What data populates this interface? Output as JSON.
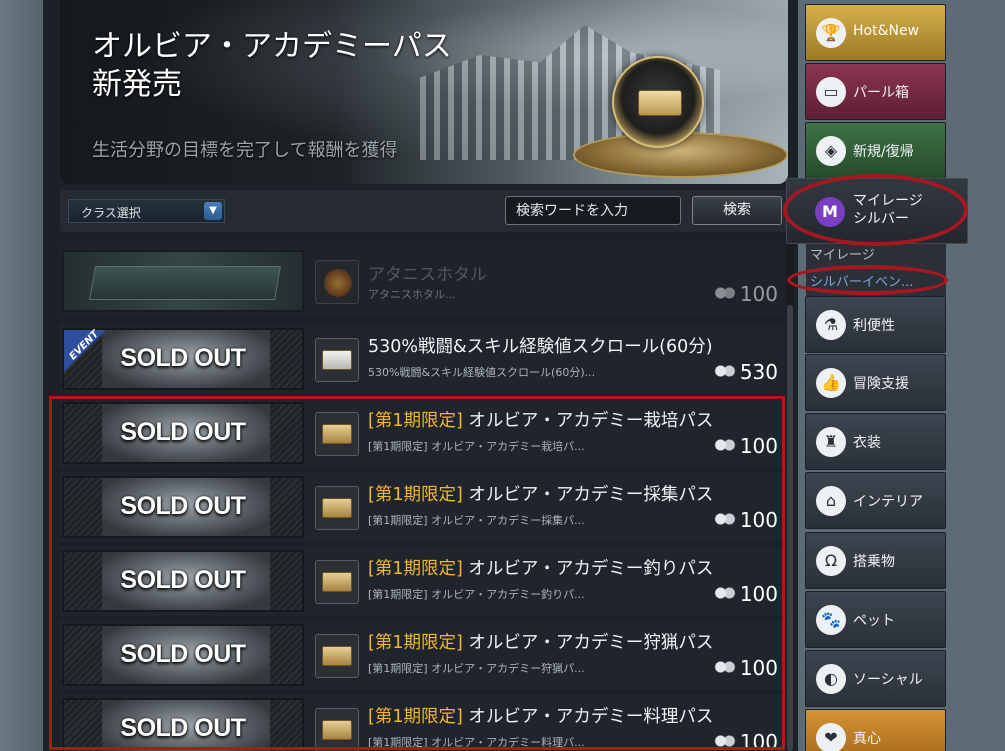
{
  "banner": {
    "title": "オルビア・アカデミーパス\n新発売",
    "subtitle": "生活分野の目標を完了して報酬を獲得"
  },
  "filter": {
    "class_select": "クラス選択",
    "search_placeholder": "検索ワードを入力",
    "search_button": "検索"
  },
  "items": [
    {
      "title": "アタニスホタル",
      "tag": "",
      "desc": "アタニスホタル...",
      "price": "100",
      "thumb": ""
    },
    {
      "title": "530%戦闘&スキル経験値スクロール(60分)",
      "tag": "",
      "desc": "530%戦闘&スキル経験値スクロール(60分)...",
      "price": "530",
      "thumb": "SOLD OUT",
      "ribbon": "EVENT"
    },
    {
      "title": "オルビア・アカデミー栽培パス",
      "tag": "[第1期限定]",
      "desc": "[第1期限定] オルビア・アカデミー栽培パ...",
      "price": "100",
      "thumb": "SOLD OUT"
    },
    {
      "title": "オルビア・アカデミー採集パス",
      "tag": "[第1期限定]",
      "desc": "[第1期限定] オルビア・アカデミー採集パ...",
      "price": "100",
      "thumb": "SOLD OUT"
    },
    {
      "title": "オルビア・アカデミー釣りパス",
      "tag": "[第1期限定]",
      "desc": "[第1期限定] オルビア・アカデミー釣りパ...",
      "price": "100",
      "thumb": "SOLD OUT"
    },
    {
      "title": "オルビア・アカデミー狩猟パス",
      "tag": "[第1期限定]",
      "desc": "[第1期限定] オルビア・アカデミー狩猟パ...",
      "price": "100",
      "thumb": "SOLD OUT"
    },
    {
      "title": "オルビア・アカデミー料理パス",
      "tag": "[第1期限定]",
      "desc": "[第1期限定] オルビア・アカデミー料理パ...",
      "price": "100",
      "thumb": "SOLD OUT"
    }
  ],
  "sidebar": {
    "items": [
      {
        "label": "Hot&New",
        "icon": "trophy-icon"
      },
      {
        "label": "パール箱",
        "icon": "pearl-box-icon"
      },
      {
        "label": "新規/復帰",
        "icon": "return-icon"
      },
      {
        "label": "マイレージ\nシルバー",
        "icon": "mileage-icon"
      },
      {
        "label": "利便性",
        "icon": "potion-icon"
      },
      {
        "label": "冒険支援",
        "icon": "thumbs-up-icon"
      },
      {
        "label": "衣装",
        "icon": "costume-icon"
      },
      {
        "label": "インテリア",
        "icon": "chair-icon"
      },
      {
        "label": "搭乗物",
        "icon": "horseshoe-icon"
      },
      {
        "label": "ペット",
        "icon": "paw-icon"
      },
      {
        "label": "ソーシャル",
        "icon": "social-icon"
      },
      {
        "label": "真心",
        "icon": "heart-icon"
      }
    ],
    "sub_items": [
      "マイレージ",
      "シルバーイベン..."
    ]
  },
  "colors": {
    "accent_tag": "#f0b630",
    "highlight": "#b01717",
    "sidebar_active": "#7a3fc0"
  }
}
